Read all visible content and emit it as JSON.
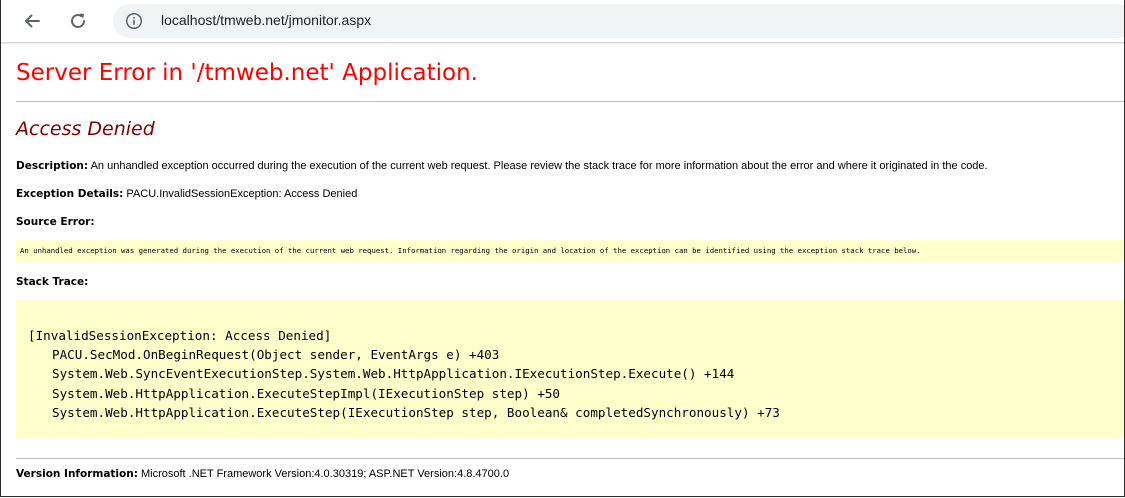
{
  "browser": {
    "url": "localhost/tmweb.net/jmonitor.aspx"
  },
  "error": {
    "title": "Server Error in '/tmweb.net' Application.",
    "heading": "Access Denied",
    "description_label": "Description:",
    "description_text": "An unhandled exception occurred during the execution of the current web request. Please review the stack trace for more information about the error and where it originated in the code.",
    "exception_label": "Exception Details:",
    "exception_text": "PACU.InvalidSessionException: Access Denied",
    "source_error_label": "Source Error:",
    "source_error_text": "An unhandled exception was generated during the execution of the current web request. Information regarding the origin and location of the exception can be identified using the exception stack trace below.",
    "stack_trace_label": "Stack Trace:",
    "stack_trace": [
      "[InvalidSessionException: Access Denied]",
      "PACU.SecMod.OnBeginRequest(Object sender, EventArgs e) +403",
      "System.Web.SyncEventExecutionStep.System.Web.HttpApplication.IExecutionStep.Execute() +144",
      "System.Web.HttpApplication.ExecuteStepImpl(IExecutionStep step) +50",
      "System.Web.HttpApplication.ExecuteStep(IExecutionStep step, Boolean& completedSynchronously) +73"
    ],
    "version_label": "Version Information:",
    "version_text": "Microsoft .NET Framework Version:4.0.30319; ASP.NET Version:4.8.4700.0"
  },
  "colors": {
    "title_red": "#ff0000",
    "heading_maroon": "#800000",
    "code_background": "#ffffcc"
  },
  "icons": {
    "back": "back-arrow-icon",
    "reload": "reload-icon",
    "info": "info-icon"
  }
}
